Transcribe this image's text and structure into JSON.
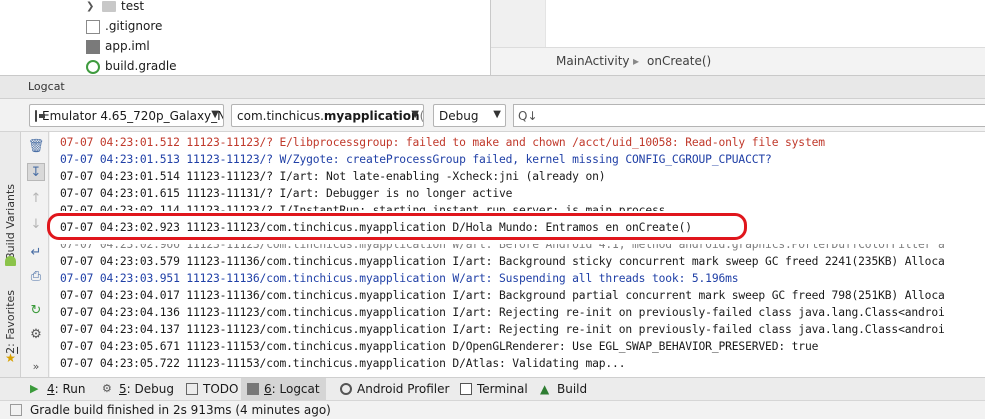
{
  "project_tree": {
    "items": [
      {
        "label": "test",
        "icon": "folder-icon"
      },
      {
        "label": ".gitignore",
        "icon": "git-file-icon"
      },
      {
        "label": "app.iml",
        "icon": "module-file-icon"
      },
      {
        "label": "build.gradle",
        "icon": "gradle-file-icon"
      }
    ]
  },
  "editor": {
    "breadcrumb": [
      "MainActivity",
      "onCreate()"
    ]
  },
  "logcat": {
    "title": "Logcat",
    "device": "Emulator 4.65_720p_Galaxy_N",
    "process_prefix": "com.tinchicus.",
    "process_bold": "myapplication",
    "process_suffix": " (1",
    "log_level": "Debug",
    "search_placeholder": "Q↓",
    "lines": [
      {
        "text": "07-07 04:23:01.512 11123-11123/? E/libprocessgroup: failed to make and chown /acct/uid_10058: Read-only file system",
        "level": "E"
      },
      {
        "text": "07-07 04:23:01.513 11123-11123/? W/Zygote: createProcessGroup failed, kernel missing CONFIG_CGROUP_CPUACCT?",
        "level": "W"
      },
      {
        "text": "07-07 04:23:01.514 11123-11123/? I/art: Not late-enabling -Xcheck:jni (already on)",
        "level": "I"
      },
      {
        "text": "07-07 04:23:01.615 11123-11131/? I/art: Debugger is no longer active",
        "level": "I"
      },
      {
        "text": "07-07 04:23:02.114 11123-11123/? I/InstantRun: starting instant run server: is main process",
        "level": "I"
      },
      {
        "text": "07-07 04:23:02.923 11123-11123/com.tinchicus.myapplication D/Hola Mundo: Entramos en onCreate()",
        "level": "D"
      },
      {
        "text": "07-07 04:23:02.966 11123-11123/com.tinchicus.myapplication W/art: Before Android 4.1, method android.graphics.PorterDuffColorFilter a",
        "level": "hidden"
      },
      {
        "text": "07-07 04:23:03.579 11123-11136/com.tinchicus.myapplication I/art: Background sticky concurrent mark sweep GC freed 2241(235KB) Alloca",
        "level": "I"
      },
      {
        "text": "07-07 04:23:03.951 11123-11136/com.tinchicus.myapplication W/art: Suspending all threads took: 5.196ms",
        "level": "W"
      },
      {
        "text": "07-07 04:23:04.017 11123-11136/com.tinchicus.myapplication I/art: Background partial concurrent mark sweep GC freed 798(251KB) Alloca",
        "level": "I"
      },
      {
        "text": "07-07 04:23:04.136 11123-11123/com.tinchicus.myapplication I/art: Rejecting re-init on previously-failed class java.lang.Class<androi",
        "level": "I"
      },
      {
        "text": "07-07 04:23:04.137 11123-11123/com.tinchicus.myapplication I/art: Rejecting re-init on previously-failed class java.lang.Class<androi",
        "level": "I"
      },
      {
        "text": "07-07 04:23:05.671 11123-11153/com.tinchicus.myapplication D/OpenGLRenderer: Use EGL_SWAP_BEHAVIOR_PRESERVED: true",
        "level": "D"
      },
      {
        "text": "07-07 04:23:05.722 11123-11153/com.tinchicus.myapplication D/Atlas: Validating map...",
        "level": "D"
      }
    ]
  },
  "left_strip": {
    "build_variants": "Build Variants",
    "favorites_num": "2",
    "favorites_label": ": Favorites"
  },
  "tool_windows": [
    {
      "num": "4",
      "label": ": Run"
    },
    {
      "num": "5",
      "label": ": Debug"
    },
    {
      "num": "",
      "label": "TODO"
    },
    {
      "num": "6",
      "label": ": Logcat"
    },
    {
      "num": "",
      "label": "Android Profiler"
    },
    {
      "num": "",
      "label": "Terminal"
    },
    {
      "num": "",
      "label": "Build"
    }
  ],
  "status": {
    "text": "Gradle build finished in 2s 913ms (4 minutes ago)"
  },
  "colors": {
    "error": "#c0392b",
    "warning": "#1f3fa6",
    "highlight": "#e0161c"
  }
}
